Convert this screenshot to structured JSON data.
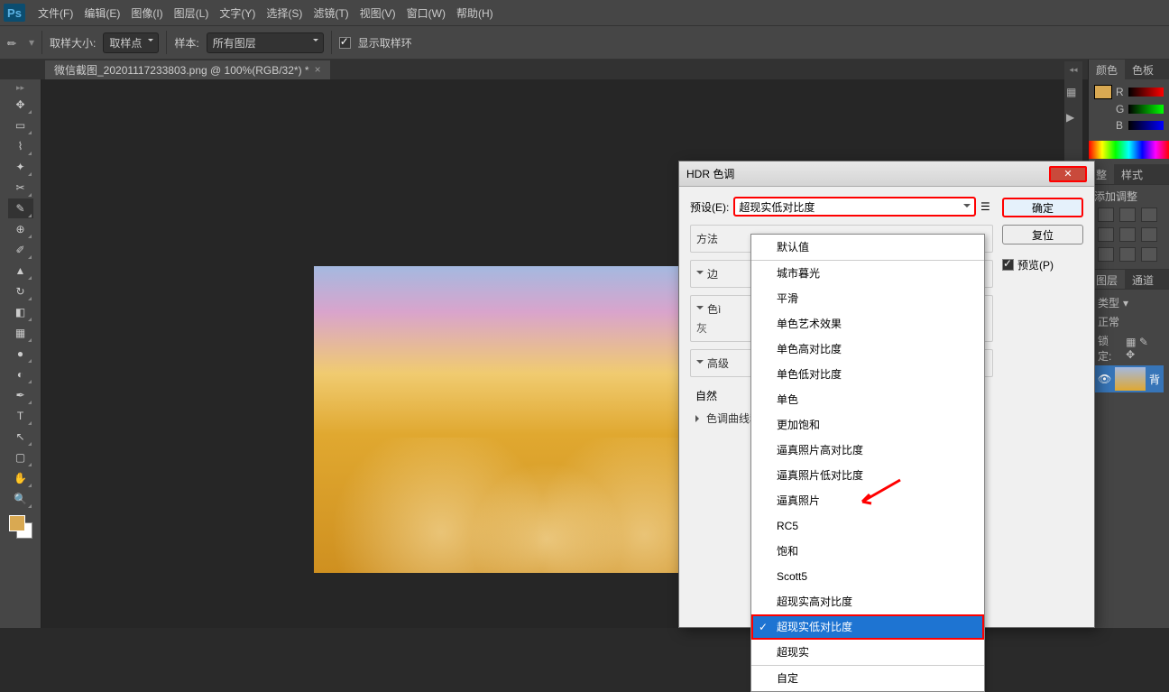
{
  "menubar": {
    "items": [
      "文件(F)",
      "编辑(E)",
      "图像(I)",
      "图层(L)",
      "文字(Y)",
      "选择(S)",
      "滤镜(T)",
      "视图(V)",
      "窗口(W)",
      "帮助(H)"
    ]
  },
  "optbar": {
    "sample_size_label": "取样大小:",
    "sample_size_value": "取样点",
    "sample_label": "样本:",
    "sample_value": "所有图层",
    "show_ring": "显示取样环"
  },
  "tab_title": "微信截图_20201117233803.png @ 100%(RGB/32*) *",
  "dialog": {
    "title": "HDR 色调",
    "preset_label": "预设(E):",
    "preset_value": "超现实低对比度",
    "ok": "确定",
    "reset": "复位",
    "preview": "预览(P)",
    "sections": {
      "method": "方法",
      "edge": "边",
      "tone": "色ì",
      "gray": "灰",
      "advanced": "高级",
      "natural": "自然",
      "curve": "色调曲线和直方图"
    },
    "options": [
      "默认值",
      "城市暮光",
      "平滑",
      "单色艺术效果",
      "单色高对比度",
      "单色低对比度",
      "单色",
      "更加饱和",
      "逼真照片高对比度",
      "逼真照片低对比度",
      "逼真照片",
      "RC5",
      "饱和",
      "Scott5",
      "超现实高对比度",
      "超现实低对比度",
      "超现实",
      "自定"
    ],
    "selected_index": 15,
    "sep_index": 17
  },
  "panels": {
    "color_tab": "颜色",
    "swatch_tab": "色板",
    "adjust_tab": "整",
    "style_tab": "样式",
    "add_adjust": "添加调整",
    "layer_tab": "图层",
    "channel_tab": "通道",
    "type_label": "类型",
    "normal": "正常",
    "lock": "锁定:",
    "bg_layer": "背",
    "ch": {
      "r": "R",
      "g": "G",
      "b": "B"
    }
  }
}
